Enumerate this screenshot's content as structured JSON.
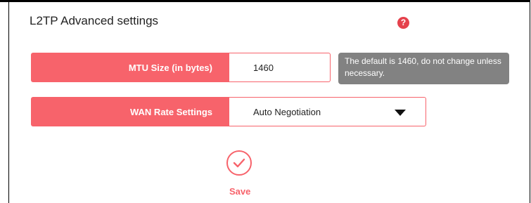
{
  "section": {
    "title": "L2TP Advanced settings",
    "help_icon": "question-icon"
  },
  "mtu": {
    "label": "MTU Size (in bytes)",
    "value": "1460",
    "hint": "The default is 1460, do not change unless necessary."
  },
  "wan": {
    "label": "WAN Rate Settings",
    "value": "Auto Negotiation"
  },
  "save": {
    "label": "Save",
    "icon": "check-circle-icon"
  },
  "colors": {
    "accent": "#f7636b",
    "tooltip_bg": "#828282",
    "help_icon": "#e5414c"
  }
}
